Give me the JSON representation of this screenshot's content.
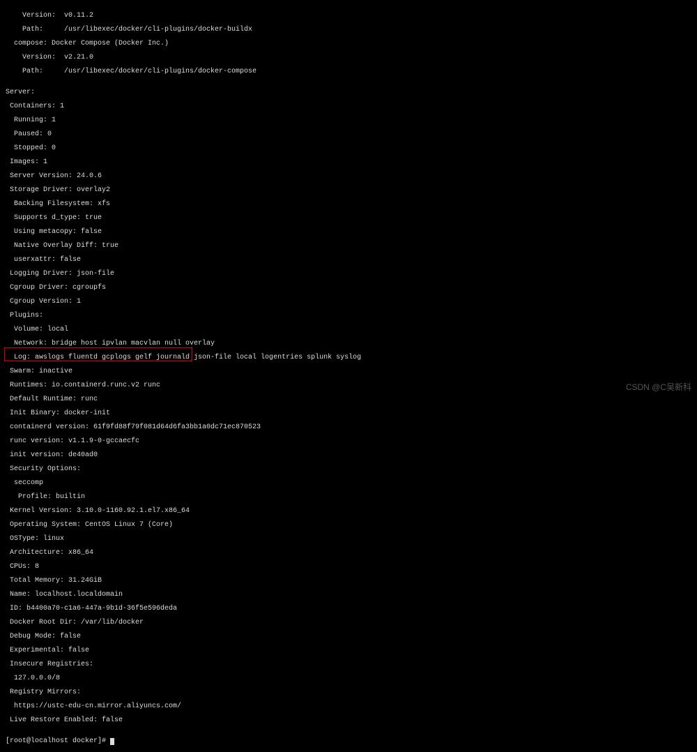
{
  "lines": {
    "l0": "    Version:  v0.11.2",
    "l1": "    Path:     /usr/libexec/docker/cli-plugins/docker-buildx",
    "l2": "  compose: Docker Compose (Docker Inc.)",
    "l3": "    Version:  v2.21.0",
    "l4": "    Path:     /usr/libexec/docker/cli-plugins/docker-compose",
    "l5": "",
    "l6": "Server:",
    "l7": " Containers: 1",
    "l8": "  Running: 1",
    "l9": "  Paused: 0",
    "l10": "  Stopped: 0",
    "l11": " Images: 1",
    "l12": " Server Version: 24.0.6",
    "l13": " Storage Driver: overlay2",
    "l14": "  Backing Filesystem: xfs",
    "l15": "  Supports d_type: true",
    "l16": "  Using metacopy: false",
    "l17": "  Native Overlay Diff: true",
    "l18": "  userxattr: false",
    "l19": " Logging Driver: json-file",
    "l20": " Cgroup Driver: cgroupfs",
    "l21": " Cgroup Version: 1",
    "l22": " Plugins:",
    "l23": "  Volume: local",
    "l24": "  Network: bridge host ipvlan macvlan null overlay",
    "l25": "  Log: awslogs fluentd gcplogs gelf journald json-file local logentries splunk syslog",
    "l26": " Swarm: inactive",
    "l27": " Runtimes: io.containerd.runc.v2 runc",
    "l28": " Default Runtime: runc",
    "l29": " Init Binary: docker-init",
    "l30": " containerd version: 61f9fd88f79f081d64d6fa3bb1a0dc71ec870523",
    "l31": " runc version: v1.1.9-0-gccaecfc",
    "l32": " init version: de40ad0",
    "l33": " Security Options:",
    "l34": "  seccomp",
    "l35": "   Profile: builtin",
    "l36": " Kernel Version: 3.10.0-1160.92.1.el7.x86_64",
    "l37": " Operating System: CentOS Linux 7 (Core)",
    "l38": " OSType: linux",
    "l39": " Architecture: x86_64",
    "l40": " CPUs: 8",
    "l41": " Total Memory: 31.24GiB",
    "l42": " Name: localhost.localdomain",
    "l43": " ID: b4400a70-c1a6-447a-9b1d-36f5e596deda",
    "l44": " Docker Root Dir: /var/lib/docker",
    "l45": " Debug Mode: false",
    "l46": " Experimental: false",
    "l47": " Insecure Registries:",
    "l48": "  127.0.0.0/8",
    "l49": " Registry Mirrors:",
    "l50": "  https://ustc-edu-cn.mirror.aliyuncs.com/",
    "l51": " Live Restore Enabled: false",
    "l52": ""
  },
  "prompt": "[root@localhost docker]# ",
  "watermark": "CSDN @C吴新科"
}
